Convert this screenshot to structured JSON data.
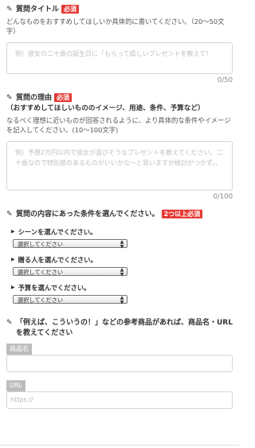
{
  "title_section": {
    "heading": "質問タイトル",
    "badge": "必須",
    "description": "どんなものをおすすめしてほしいか具体的に書いてください。（20〜50文字）",
    "placeholder": "例）彼女の二十歳の誕生日に「もらって嬉しいプレゼントを教えて！",
    "counter": "0/50"
  },
  "reason_section": {
    "heading": "質問の理由",
    "badge": "必須",
    "subtitle": "（おすすめしてほしいもののイメージ、用途、条件、予算など）",
    "description": "なるべく理想に近いものが回答されるように、より具体的な条件やイメージを記入してください。(10〜100文字)",
    "placeholder": "例）予算2万円以内で彼女が喜びそうなプレゼントを教えてください。二十歳なので特別感のあるものがいいかな～と思いますが検討がつかず。。",
    "counter": "0/100"
  },
  "conditions_section": {
    "heading": "質問の内容にあった条件を選んでください。",
    "badge": "2つ以上必須",
    "items": [
      {
        "label": "シーンを選んでください。",
        "selected": "選択してください"
      },
      {
        "label": "贈る人を選んでください。",
        "selected": "選択してください"
      },
      {
        "label": "予算を選んでください。",
        "selected": "選択してください"
      }
    ]
  },
  "reference_section": {
    "heading": "「例えば、こういうの！」などの参考商品があれば、商品名・URLを教えてください",
    "product_label": "商品名",
    "product_value": "",
    "url_label": "URL",
    "url_placeholder": "https://"
  },
  "icons": {
    "heading_icon": "pencil-icon",
    "condition_icon": "triangle-right-icon",
    "select_icon": "up-down-arrows-icon"
  },
  "colors": {
    "badge": "#e53935",
    "label_bg": "#bdbdbd",
    "border": "#d6d6d6"
  }
}
